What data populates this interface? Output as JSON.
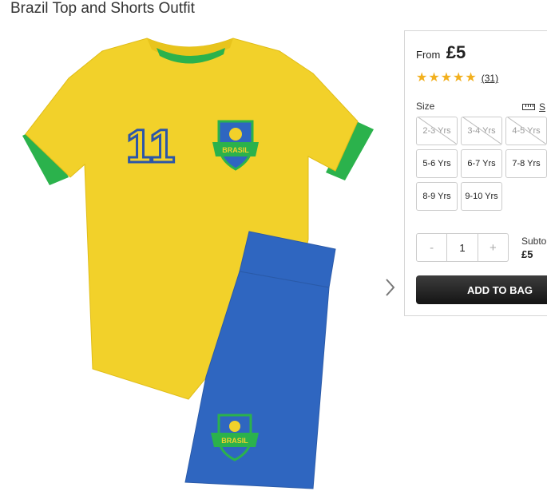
{
  "product": {
    "title": "Brazil Top and Shorts Outfit",
    "shirt_number": "11",
    "crest_text": "BRASIL"
  },
  "buy_panel": {
    "from_label": "From",
    "price": "£5",
    "rating": {
      "stars": 5,
      "review_count": "(31)"
    },
    "size_label": "Size",
    "size_guide_label": "S",
    "sizes": [
      {
        "label": "2-3 Yrs",
        "available": false
      },
      {
        "label": "3-4 Yrs",
        "available": false
      },
      {
        "label": "4-5 Yrs",
        "available": false
      },
      {
        "label": "5-6 Yrs",
        "available": true
      },
      {
        "label": "6-7 Yrs",
        "available": true
      },
      {
        "label": "7-8 Yrs",
        "available": true
      },
      {
        "label": "8-9 Yrs",
        "available": true
      },
      {
        "label": "9-10 Yrs",
        "available": true
      }
    ],
    "quantity": {
      "minus": "-",
      "value": "1",
      "plus": "+"
    },
    "subtotal_label": "Subto",
    "subtotal_value": "£5",
    "add_to_bag_label": "ADD TO BAG"
  },
  "colors": {
    "shirt": "#f2d12a",
    "trim": "#2bb24c",
    "shorts": "#2f66c0",
    "star": "#f2b01e",
    "button": "#1f1f1f"
  }
}
